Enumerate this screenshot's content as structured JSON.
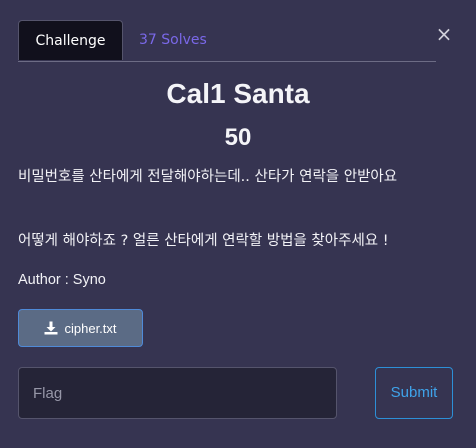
{
  "tabs": {
    "challenge": "Challenge",
    "solves": "37 Solves"
  },
  "close_label": "×",
  "challenge": {
    "name": "Cal1 Santa",
    "value": "50",
    "description_line1": "비밀번호를 산타에게 전달해야하는데.. 산타가 연락을 안받아요",
    "description_line2": "어떻게 해야하죠 ? 얼른 산타에게 연락할 방법을 찾아주세요 !",
    "author": "Author : Syno"
  },
  "file": {
    "name": "cipher.txt",
    "icon": "download-icon"
  },
  "form": {
    "flag_placeholder": "Flag",
    "flag_value": "",
    "submit_label": "Submit"
  },
  "colors": {
    "background": "#363451",
    "active_tab": "#11101c",
    "solves_link": "#7a68e8",
    "file_button": "#5b6b85",
    "submit_accent": "#3fa3ea"
  }
}
